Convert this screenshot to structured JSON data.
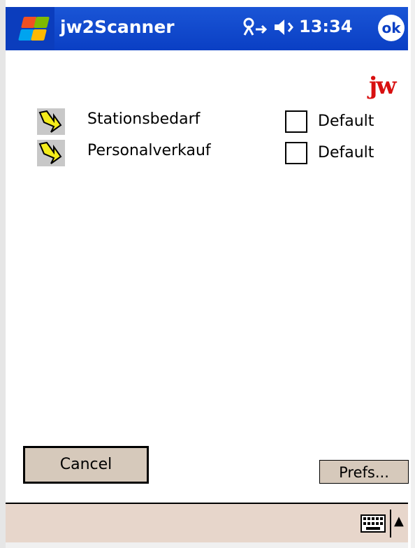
{
  "titlebar": {
    "app_title": "jw2Scanner",
    "clock": "13:34",
    "ok_label": "ok",
    "connectivity_icon": "connectivity-icon",
    "volume_icon": "speaker-icon"
  },
  "logo": {
    "text": "jw"
  },
  "rows": [
    {
      "label": "Stationsbedarf",
      "checkbox_label": "Default",
      "checked": false
    },
    {
      "label": "Personalverkauf",
      "checkbox_label": "Default",
      "checked": false
    }
  ],
  "buttons": {
    "cancel": "Cancel",
    "prefs": "Prefs..."
  },
  "colors": {
    "titlebar": "#0a3fc4",
    "logo": "#d81010",
    "button_face": "#d6c9bb",
    "menubar": "#e7d6cb"
  }
}
